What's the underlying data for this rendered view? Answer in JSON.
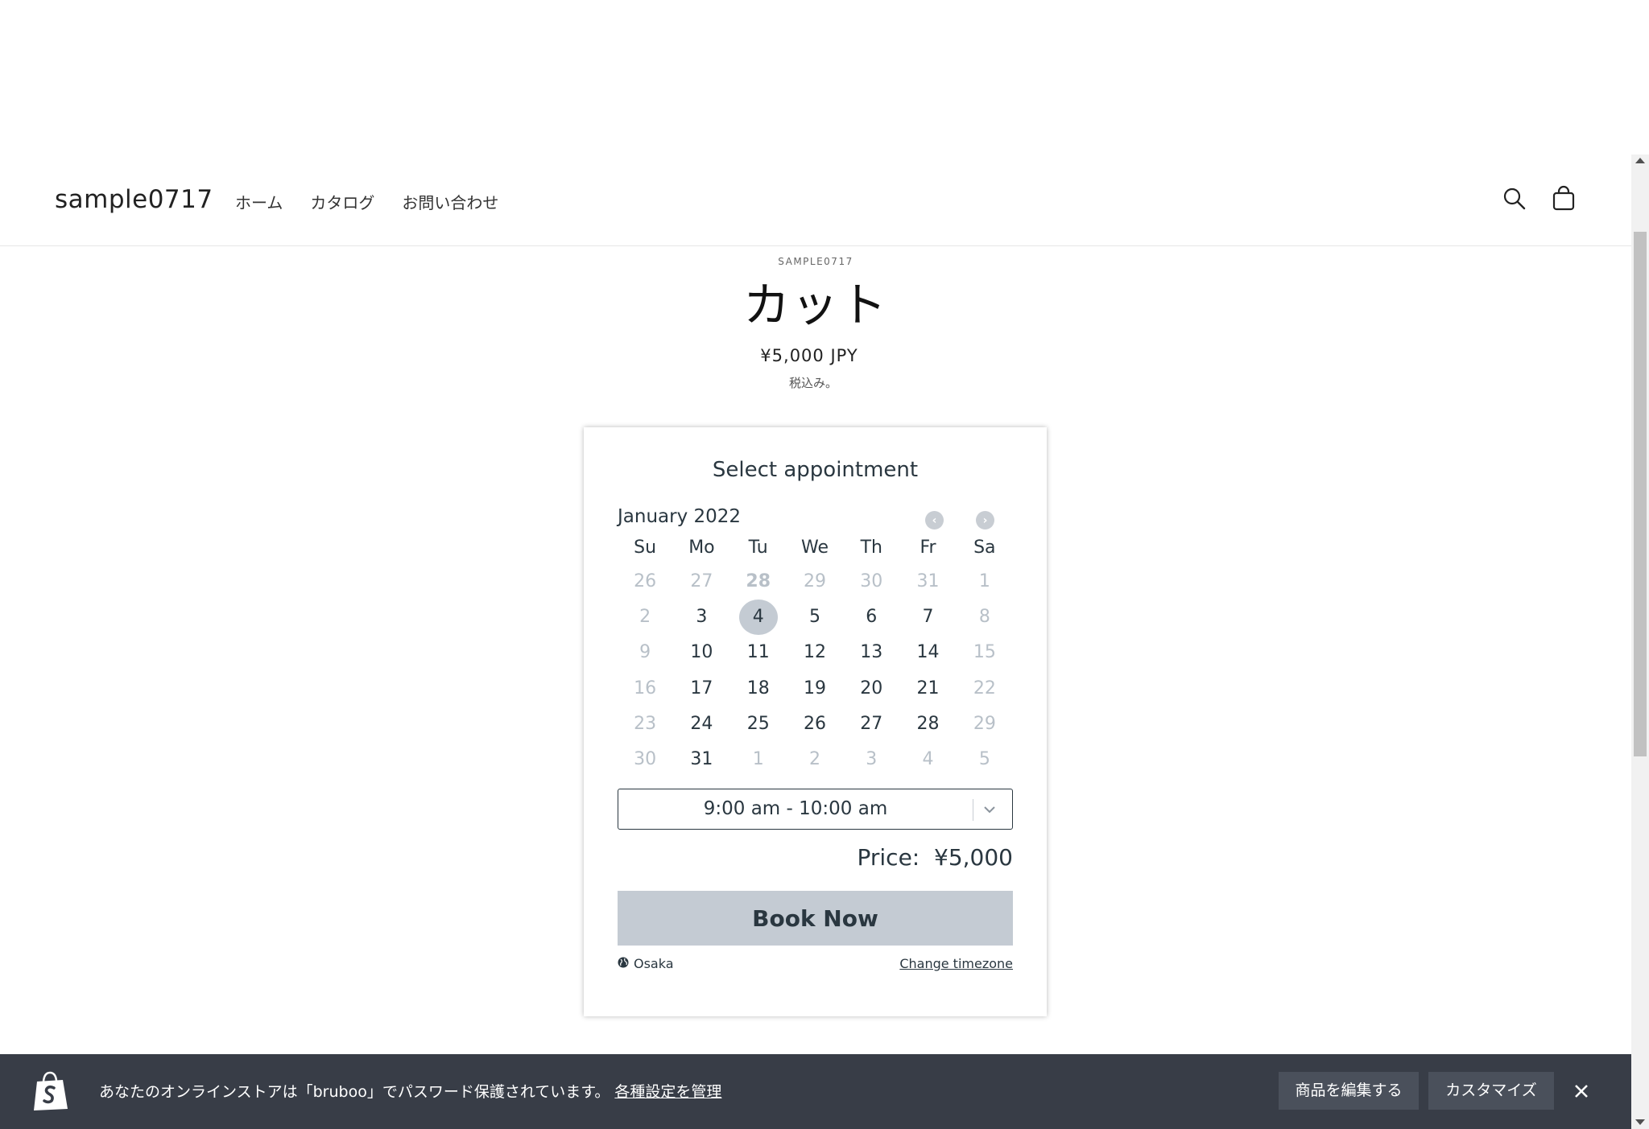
{
  "header": {
    "logo": "sample0717",
    "nav": [
      {
        "label": "ホーム"
      },
      {
        "label": "カタログ"
      },
      {
        "label": "お問い合わせ"
      }
    ],
    "icons": [
      "search-icon",
      "cart-icon"
    ]
  },
  "product": {
    "vendor": "SAMPLE0717",
    "title": "カット",
    "price": "¥5,000 JPY",
    "tax_note": "税込み。"
  },
  "booking": {
    "title": "Select appointment",
    "month": "January 2022",
    "weekdays": [
      "Su",
      "Mo",
      "Tu",
      "We",
      "Th",
      "Fr",
      "Sa"
    ],
    "weeks": [
      [
        {
          "d": "26",
          "s": "muted"
        },
        {
          "d": "27",
          "s": "muted"
        },
        {
          "d": "28",
          "s": "muted bold"
        },
        {
          "d": "29",
          "s": "muted"
        },
        {
          "d": "30",
          "s": "muted"
        },
        {
          "d": "31",
          "s": "muted"
        },
        {
          "d": "1",
          "s": "muted"
        }
      ],
      [
        {
          "d": "2",
          "s": "muted"
        },
        {
          "d": "3",
          "s": ""
        },
        {
          "d": "4",
          "s": "selected"
        },
        {
          "d": "5",
          "s": ""
        },
        {
          "d": "6",
          "s": ""
        },
        {
          "d": "7",
          "s": ""
        },
        {
          "d": "8",
          "s": "muted"
        }
      ],
      [
        {
          "d": "9",
          "s": "muted"
        },
        {
          "d": "10",
          "s": ""
        },
        {
          "d": "11",
          "s": ""
        },
        {
          "d": "12",
          "s": ""
        },
        {
          "d": "13",
          "s": ""
        },
        {
          "d": "14",
          "s": ""
        },
        {
          "d": "15",
          "s": "muted"
        }
      ],
      [
        {
          "d": "16",
          "s": "muted"
        },
        {
          "d": "17",
          "s": ""
        },
        {
          "d": "18",
          "s": ""
        },
        {
          "d": "19",
          "s": ""
        },
        {
          "d": "20",
          "s": ""
        },
        {
          "d": "21",
          "s": ""
        },
        {
          "d": "22",
          "s": "muted"
        }
      ],
      [
        {
          "d": "23",
          "s": "muted"
        },
        {
          "d": "24",
          "s": ""
        },
        {
          "d": "25",
          "s": ""
        },
        {
          "d": "26",
          "s": ""
        },
        {
          "d": "27",
          "s": ""
        },
        {
          "d": "28",
          "s": ""
        },
        {
          "d": "29",
          "s": "muted"
        }
      ],
      [
        {
          "d": "30",
          "s": "muted"
        },
        {
          "d": "31",
          "s": ""
        },
        {
          "d": "1",
          "s": "muted"
        },
        {
          "d": "2",
          "s": "muted"
        },
        {
          "d": "3",
          "s": "muted"
        },
        {
          "d": "4",
          "s": "muted"
        },
        {
          "d": "5",
          "s": "muted"
        }
      ]
    ],
    "time_slot": "9:00 am - 10:00 am",
    "price": "Price:  ¥5,000",
    "book_label": "Book Now",
    "timezone": "Osaka",
    "change_timezone": "Change timezone"
  },
  "admin_bar": {
    "message": "あなたのオンラインストアは「bruboo」でパスワード保護されています。",
    "manage_link": "各種設定を管理",
    "edit_button": "商品を編集する",
    "customize_button": "カスタマイズ"
  },
  "colors": {
    "accent": "#2a3740",
    "selected_day": "#c4cbd3",
    "admin_bar": "#383d47"
  }
}
